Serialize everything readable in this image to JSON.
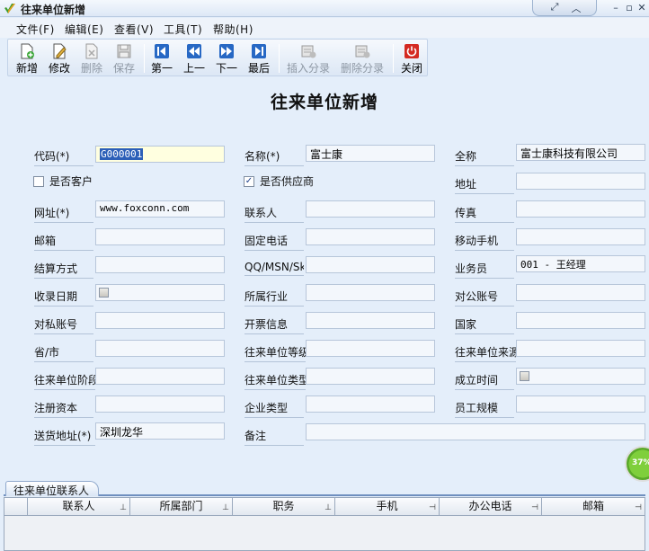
{
  "window": {
    "title": "往来单位新增"
  },
  "menu": [
    {
      "label": "文件(F)"
    },
    {
      "label": "编辑(E)"
    },
    {
      "label": "查看(V)"
    },
    {
      "label": "工具(T)"
    },
    {
      "label": "帮助(H)"
    }
  ],
  "toolbar": {
    "new": "新增",
    "edit": "修改",
    "delete": "删除",
    "save": "保存",
    "first": "第一",
    "prev": "上一",
    "next": "下一",
    "last": "最后",
    "insert_entry": "插入分录",
    "delete_entry": "删除分录",
    "close": "关闭"
  },
  "form": {
    "title": "往来单位新增",
    "code_label": "代码(*)",
    "code_value": "G000001",
    "name_label": "名称(*)",
    "name_value": "富士康",
    "fullname_label": "全称",
    "fullname_value": "富士康科技有限公司",
    "is_customer_label": "是否客户",
    "is_supplier_label": "是否供应商",
    "address_label": "地址",
    "website_label": "网址(*)",
    "website_value": "www.foxconn.com",
    "contact_label": "联系人",
    "fax_label": "传真",
    "postcode_label": "邮箱",
    "phone_label": "固定电话",
    "mobile_label": "移动手机",
    "settlement_label": "结算方式",
    "im_label": "QQ/MSN/Skype",
    "salesman_label": "业务员",
    "salesman_value": "001 - 王经理",
    "receipt_date_label": "收录日期",
    "industry_label": "所属行业",
    "corp_account_label": "对公账号",
    "private_account_label": "对私账号",
    "invoice_label": "开票信息",
    "country_label": "国家",
    "province_label": "省/市",
    "level_label": "往来单位等级",
    "source_label": "往来单位来源",
    "stage_label": "往来单位阶段",
    "type_label": "往来单位类型",
    "founded_label": "成立时间",
    "capital_label": "注册资本",
    "enterprise_type_label": "企业类型",
    "staff_label": "员工规模",
    "delivery_label": "送货地址(*)",
    "delivery_value": "深圳龙华",
    "remark_label": "备注"
  },
  "progress": {
    "value": "37%"
  },
  "bottom": {
    "tab_label": "往来单位联系人",
    "columns": [
      "联系人",
      "所属部门",
      "职务",
      "手机",
      "办公电话",
      "邮箱"
    ]
  },
  "colors": {
    "accent": "#2c5fb8",
    "panel": "#e4eefa",
    "close_red": "#d42a22"
  }
}
